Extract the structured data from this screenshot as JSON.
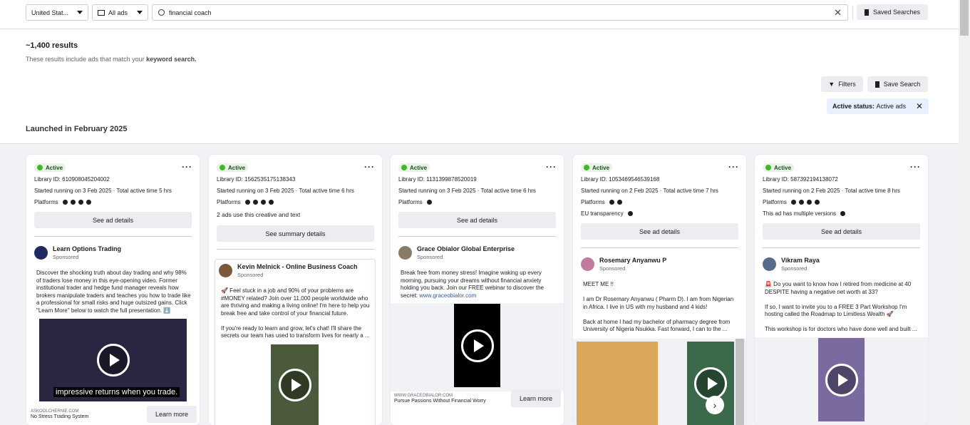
{
  "toolbar": {
    "country": "United Stat...",
    "ad_category": "All ads",
    "search_value": "financial coach",
    "saved_searches": "Saved Searches"
  },
  "summary": {
    "results": "~1,400 results",
    "note_prefix": "These results include ads that match your ",
    "note_bold": "keyword search."
  },
  "actions": {
    "filters": "Filters",
    "save_search": "Save Search",
    "chip_label": "Active status:",
    "chip_value": "Active ads"
  },
  "section_title": "Launched in February 2025",
  "cards": [
    {
      "status": "Active",
      "library_id": "Library ID: 610908045204002",
      "started": "Started running on 3 Feb 2025 · Total active time 5 hrs",
      "platforms": "Platforms",
      "button": "See ad details",
      "advertiser": "Learn Options Trading",
      "sponsored": "Sponsored",
      "text": "Discover the shocking truth about day trading and why 98% of traders lose money in this eye-opening video. Former institutional trader and hedge fund manager reveals how brokers manipulate traders and teaches you how to trade like a professional for small risks and huge outsized gains. Click \"Learn More\" below to watch the full presentation. ⬇️",
      "caption": "impressive returns when you trade.",
      "domain": "ASKOOLCHERNIE.COM",
      "footer_caption": "No Stress Trading System",
      "cta": "Learn more"
    },
    {
      "status": "Active",
      "library_id": "Library ID: 1562535175138343",
      "started": "Started running on 3 Feb 2025 · Total active time 6 hrs",
      "platforms": "Platforms",
      "extra": "2 ads use this creative and text",
      "button": "See summary details",
      "advertiser": "Kevin Melnick - Online Business Coach",
      "sponsored": "Sponsored",
      "text": "🚀 Feel stuck in a job and 90% of your problems are #MONEY related? Join over 11,000 people worldwide who are thriving and making a living online! I'm here to help you break free and take control of your financial future.\n\nIf you're ready to learn and grow, let's chat! I'll share the secrets our team has used to transform lives for nearly a ..."
    },
    {
      "status": "Active",
      "library_id": "Library ID: 1131399878520019",
      "started": "Started running on 3 Feb 2025 · Total active time 6 hrs",
      "platforms": "Platforms",
      "button": "See ad details",
      "advertiser": "Grace Obialor Global Enterprise",
      "sponsored": "Sponsored",
      "text": "Break free from money stress! Imagine waking up every morning, pursuing your dreams without financial anxiety holding you back. Join our FREE webinar to discover the secret: ",
      "link": "www.graceobialor.com",
      "domain": "WWW.GRACEOBIALOR.COM",
      "footer_caption": "Pursue Passions Without Financial Worry",
      "cta": "Learn more"
    },
    {
      "status": "Active",
      "library_id": "Library ID: 1053469546539168",
      "started": "Started running on 2 Feb 2025 · Total active time 7 hrs",
      "platforms": "Platforms",
      "extra": "EU transparency",
      "button": "See ad details",
      "advertiser": "Rosemary Anyanwu P",
      "sponsored": "Sponsored",
      "text": "MEET ME !!\n\nI am Dr Rosemary Anyanwu ( Pharm D). I am from Nigerian in Africa. I live in US  with my husband and 4 kids!\n\nBack at home I had my bachelor of pharmacy degree from University of Nigeria Nsukka.  Fast forward, I can to the ..."
    },
    {
      "status": "Active",
      "library_id": "Library ID: 587392194138072",
      "started": "Started running on 2 Feb 2025 · Total active time 8 hrs",
      "platforms": "Platforms",
      "extra": "This ad has multiple versions",
      "button": "See ad details",
      "advertiser": "Vikram Raya",
      "sponsored": "Sponsored",
      "text": "🚨 Do you want to know how I retired from medicine at 40 DESPITE having a negative net worth at 33?\n\nIf so, I want to invite you to a FREE 3 Part Workshop I'm hosting called the Roadmap to Limitless Wealth 🚀\n\nThis workshop is for doctors who have done well and built ..."
    }
  ]
}
